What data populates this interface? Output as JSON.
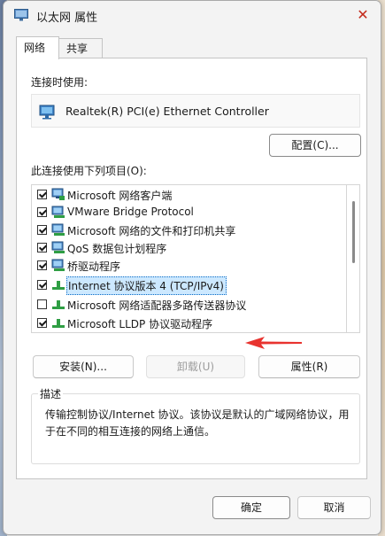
{
  "window": {
    "title": "以太网 属性",
    "accent": "#c42b1c"
  },
  "tabs": [
    {
      "label": "网络"
    },
    {
      "label": "共享"
    }
  ],
  "connect_using": {
    "label": "连接时使用:",
    "adapter": "Realtek(R) PCI(e) Ethernet Controller",
    "configure_button": "配置(C)..."
  },
  "items": {
    "label": "此连接使用下列项目(O):",
    "list": [
      {
        "label": "Microsoft 网络客户端",
        "checked": true,
        "icon": "network-client-icon"
      },
      {
        "label": "VMware Bridge Protocol",
        "checked": true,
        "icon": "network-service-icon"
      },
      {
        "label": "Microsoft 网络的文件和打印机共享",
        "checked": true,
        "icon": "network-service-icon"
      },
      {
        "label": "QoS 数据包计划程序",
        "checked": true,
        "icon": "network-service-icon"
      },
      {
        "label": "桥驱动程序",
        "checked": true,
        "icon": "network-service-icon"
      },
      {
        "label": "Internet 协议版本 4 (TCP/IPv4)",
        "checked": true,
        "selected": true,
        "icon": "protocol-icon"
      },
      {
        "label": "Microsoft 网络适配器多路传送器协议",
        "checked": false,
        "icon": "protocol-icon"
      },
      {
        "label": "Microsoft LLDP 协议驱动程序",
        "checked": true,
        "icon": "protocol-icon"
      }
    ],
    "selection_color": "#cce8ff",
    "annotation_arrow_color": "#e8332f"
  },
  "actions": {
    "install": "安装(N)...",
    "uninstall": "卸载(U)",
    "properties": "属性(R)"
  },
  "description": {
    "title": "描述",
    "text": "传输控制协议/Internet 协议。该协议是默认的广域网络协议，用于在不同的相互连接的网络上通信。"
  },
  "footer": {
    "ok": "确定",
    "cancel": "取消"
  }
}
